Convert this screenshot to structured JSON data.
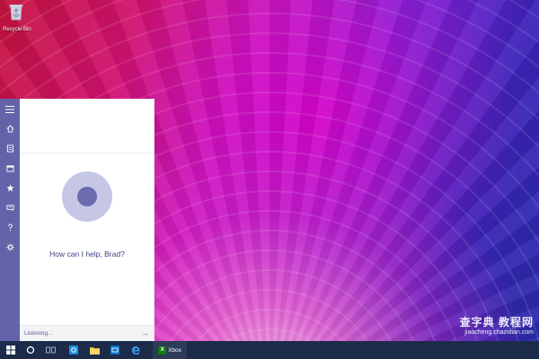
{
  "desktop": {
    "icons": [
      {
        "label": "Recycle Bin",
        "icon": "recycle-bin-icon"
      }
    ],
    "watermark": {
      "main": "查字典 教程网",
      "url": "jiaocheng.chazidian.com"
    }
  },
  "cortana": {
    "rail_icons": [
      "hamburger-menu-icon",
      "home-icon",
      "notebook-icon",
      "calendar-icon",
      "star-icon",
      "feedback-icon",
      "help-icon",
      "settings-icon"
    ],
    "prompt": "How can I help, Brad?",
    "status": "Listening...",
    "submit_glyph": "→",
    "colors": {
      "rail": "#6263a8",
      "ring": "#c6c7e6",
      "dot": "#6b6cae",
      "text": "#3f4181"
    }
  },
  "taskbar": {
    "items": [
      "start-icon",
      "search-cortana-icon",
      "task-view-icon",
      "store-icon",
      "file-explorer-icon",
      "outlook-icon",
      "edge-icon",
      "xbox-icon"
    ],
    "xbox_label": "Xbox",
    "colors": {
      "background": "#1c2b4a"
    }
  }
}
